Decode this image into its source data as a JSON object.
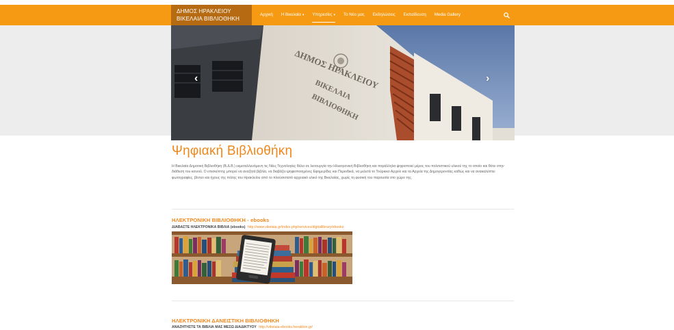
{
  "brand": {
    "line1": "ΔΗΜΟΣ ΗΡΑΚΛΕΙΟΥ",
    "line2": "ΒΙΚΕΛΑΙΑ ΒΙΒΛΙΟΘΗΚΗ"
  },
  "nav": {
    "items": [
      {
        "label": "Αρχική"
      },
      {
        "label": "Η Βικελαία"
      },
      {
        "label": "Υπηρεσίες"
      },
      {
        "label": "Το Νέο μας"
      },
      {
        "label": "Εκδηλώσεις"
      },
      {
        "label": "Εκπαίδευση"
      },
      {
        "label": "Media Gallery"
      }
    ],
    "active_index": 2,
    "search_icon": "search-icon"
  },
  "slider": {
    "prev_glyph": "‹",
    "next_glyph": "›",
    "building_sign": [
      "ΔΗΜΟΣ ΗΡΑΚΛΕΙΟΥ",
      "ΒΙΚΕΛΑΙΑ",
      "ΒΙΒΛΙΟΘΗΚΗ"
    ]
  },
  "page": {
    "title": "Ψηφιακή Βιβλιοθήκη",
    "intro": "Η Βικελαία Δημοτική Βιβλιοθήκη (Β.Δ.Β.) εκμεταλλευόμενη τις Νέες Τεχνολογίες θέλει σε λειτουργία την Ηλεκτρονική Βιβλιοθήκη και παράλληλα ψηφιοποιεί μέρος του πολιτιστικού υλικού της το οποίο και θέτει στην διάθεση του κοινού. Ο επισκέπτης μπορεί να αναζητά βιβλία, να διαβάζει ψηφιοποιημένες Εφημερίδες και Περιοδικά, να μελετά το Τούρκικο Αρχείο και τα Αρχεία της Δημογεροντίας καθώς και να ανακαλύπτει φωτογραφίες, βίντεο και ήχους της πόλης του Ηρακλείου από το πλούσιοτατό αρχειακό υλικό της Βικελαίας, χωρίς τη φυσική του παρουσία στο χώρο της."
  },
  "sections": [
    {
      "title": "ΗΛΕΚΤΡΟΝΙΚΗ ΒΙΒΛΙΟΘΗΚΗ - ebooks",
      "line_label": "ΔΙΑΒΑΣΤΕ ΗΛΕΚΤΡΟΝΙΚΑ ΒΙΒΛΙΑ (ebooks)",
      "link": "http://www.vikelaia.gr/index.php/services/digitallibrary/ebooks"
    },
    {
      "title": "ΗΛΕΚΤΡΟΝΙΚΗ ΔΑΝΕΙΣΤΙΚΗ ΒΙΒΛΙΟΘΗΚΗ",
      "line_label": "ΑΝΑΖΗΤΗΣΤΕ ΤΑ ΒΙΒΛΙΑ ΜΑΣ ΜΕΣΩ ΔΙΑΔΙΚΤΥΟΥ",
      "link": "http://vikelaia-ebooks.heraklion.gr/"
    }
  ],
  "colors": {
    "accent": "#f59a12",
    "brand_bg": "#b66a12",
    "title": "#f0871a"
  }
}
